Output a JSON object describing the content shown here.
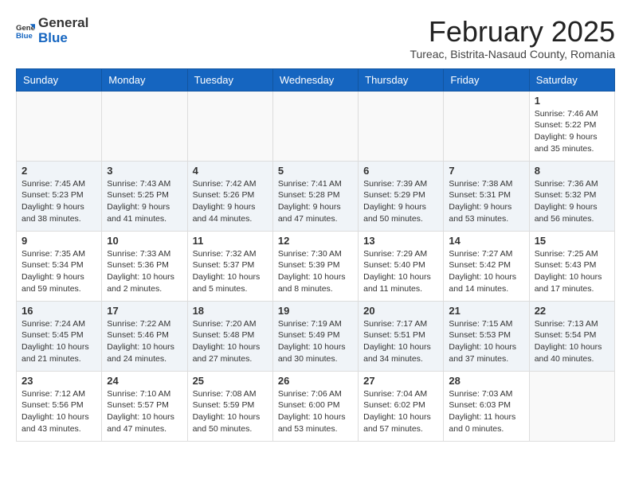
{
  "header": {
    "logo_general": "General",
    "logo_blue": "Blue",
    "month_title": "February 2025",
    "location": "Tureac, Bistrita-Nasaud County, Romania"
  },
  "weekdays": [
    "Sunday",
    "Monday",
    "Tuesday",
    "Wednesday",
    "Thursday",
    "Friday",
    "Saturday"
  ],
  "weeks": [
    [
      {
        "day": "",
        "info": ""
      },
      {
        "day": "",
        "info": ""
      },
      {
        "day": "",
        "info": ""
      },
      {
        "day": "",
        "info": ""
      },
      {
        "day": "",
        "info": ""
      },
      {
        "day": "",
        "info": ""
      },
      {
        "day": "1",
        "info": "Sunrise: 7:46 AM\nSunset: 5:22 PM\nDaylight: 9 hours and 35 minutes."
      }
    ],
    [
      {
        "day": "2",
        "info": "Sunrise: 7:45 AM\nSunset: 5:23 PM\nDaylight: 9 hours and 38 minutes."
      },
      {
        "day": "3",
        "info": "Sunrise: 7:43 AM\nSunset: 5:25 PM\nDaylight: 9 hours and 41 minutes."
      },
      {
        "day": "4",
        "info": "Sunrise: 7:42 AM\nSunset: 5:26 PM\nDaylight: 9 hours and 44 minutes."
      },
      {
        "day": "5",
        "info": "Sunrise: 7:41 AM\nSunset: 5:28 PM\nDaylight: 9 hours and 47 minutes."
      },
      {
        "day": "6",
        "info": "Sunrise: 7:39 AM\nSunset: 5:29 PM\nDaylight: 9 hours and 50 minutes."
      },
      {
        "day": "7",
        "info": "Sunrise: 7:38 AM\nSunset: 5:31 PM\nDaylight: 9 hours and 53 minutes."
      },
      {
        "day": "8",
        "info": "Sunrise: 7:36 AM\nSunset: 5:32 PM\nDaylight: 9 hours and 56 minutes."
      }
    ],
    [
      {
        "day": "9",
        "info": "Sunrise: 7:35 AM\nSunset: 5:34 PM\nDaylight: 9 hours and 59 minutes."
      },
      {
        "day": "10",
        "info": "Sunrise: 7:33 AM\nSunset: 5:36 PM\nDaylight: 10 hours and 2 minutes."
      },
      {
        "day": "11",
        "info": "Sunrise: 7:32 AM\nSunset: 5:37 PM\nDaylight: 10 hours and 5 minutes."
      },
      {
        "day": "12",
        "info": "Sunrise: 7:30 AM\nSunset: 5:39 PM\nDaylight: 10 hours and 8 minutes."
      },
      {
        "day": "13",
        "info": "Sunrise: 7:29 AM\nSunset: 5:40 PM\nDaylight: 10 hours and 11 minutes."
      },
      {
        "day": "14",
        "info": "Sunrise: 7:27 AM\nSunset: 5:42 PM\nDaylight: 10 hours and 14 minutes."
      },
      {
        "day": "15",
        "info": "Sunrise: 7:25 AM\nSunset: 5:43 PM\nDaylight: 10 hours and 17 minutes."
      }
    ],
    [
      {
        "day": "16",
        "info": "Sunrise: 7:24 AM\nSunset: 5:45 PM\nDaylight: 10 hours and 21 minutes."
      },
      {
        "day": "17",
        "info": "Sunrise: 7:22 AM\nSunset: 5:46 PM\nDaylight: 10 hours and 24 minutes."
      },
      {
        "day": "18",
        "info": "Sunrise: 7:20 AM\nSunset: 5:48 PM\nDaylight: 10 hours and 27 minutes."
      },
      {
        "day": "19",
        "info": "Sunrise: 7:19 AM\nSunset: 5:49 PM\nDaylight: 10 hours and 30 minutes."
      },
      {
        "day": "20",
        "info": "Sunrise: 7:17 AM\nSunset: 5:51 PM\nDaylight: 10 hours and 34 minutes."
      },
      {
        "day": "21",
        "info": "Sunrise: 7:15 AM\nSunset: 5:53 PM\nDaylight: 10 hours and 37 minutes."
      },
      {
        "day": "22",
        "info": "Sunrise: 7:13 AM\nSunset: 5:54 PM\nDaylight: 10 hours and 40 minutes."
      }
    ],
    [
      {
        "day": "23",
        "info": "Sunrise: 7:12 AM\nSunset: 5:56 PM\nDaylight: 10 hours and 43 minutes."
      },
      {
        "day": "24",
        "info": "Sunrise: 7:10 AM\nSunset: 5:57 PM\nDaylight: 10 hours and 47 minutes."
      },
      {
        "day": "25",
        "info": "Sunrise: 7:08 AM\nSunset: 5:59 PM\nDaylight: 10 hours and 50 minutes."
      },
      {
        "day": "26",
        "info": "Sunrise: 7:06 AM\nSunset: 6:00 PM\nDaylight: 10 hours and 53 minutes."
      },
      {
        "day": "27",
        "info": "Sunrise: 7:04 AM\nSunset: 6:02 PM\nDaylight: 10 hours and 57 minutes."
      },
      {
        "day": "28",
        "info": "Sunrise: 7:03 AM\nSunset: 6:03 PM\nDaylight: 11 hours and 0 minutes."
      },
      {
        "day": "",
        "info": ""
      }
    ]
  ]
}
